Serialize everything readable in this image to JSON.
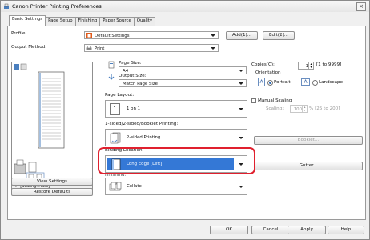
{
  "window": {
    "title": "Canon Printer Printing Preferences",
    "close": "×"
  },
  "tabs": [
    {
      "label": "Basic Settings",
      "active": true
    },
    {
      "label": "Page Setup"
    },
    {
      "label": "Finishing"
    },
    {
      "label": "Paper Source"
    },
    {
      "label": "Quality"
    }
  ],
  "profile": {
    "label": "Profile:",
    "value": "Default Settings",
    "add": "Add(1)...",
    "edit": "Edit(2)..."
  },
  "output_method": {
    "label": "Output Method:",
    "value": "Print"
  },
  "preview": {
    "status": "A4 [Scaling: Auto]"
  },
  "left_buttons": {
    "view_settings": "View Settings",
    "restore_defaults": "Restore Defaults"
  },
  "page_size": {
    "label": "Page Size:",
    "value": "A4"
  },
  "output_size": {
    "label": "Output Size:",
    "value": "Match Page Size"
  },
  "page_layout": {
    "label": "Page Layout:",
    "value": "1 on 1",
    "icon_text": "1"
  },
  "printing": {
    "label": "1-sided/2-sided/Booklet Printing:",
    "value": "2-sided Printing"
  },
  "binding": {
    "label": "Binding Location:",
    "value": "Long Edge [Left]",
    "partial_label": "Finishing:"
  },
  "finishing": {
    "value": "Collate"
  },
  "copies": {
    "label": "Copies(C):",
    "value": "1",
    "range": "[1 to 9999]"
  },
  "orientation": {
    "label": "Orientation",
    "portrait": "Portrait",
    "landscape": "Landscape",
    "selected": "portrait"
  },
  "manual_scaling": {
    "label": "Manual Scaling",
    "scaling_label": "Scaling:",
    "value": "100",
    "range": "% [25 to 200]"
  },
  "buttons": {
    "booklet": "Booklet...",
    "gutter": "Gutter...",
    "ok": "OK",
    "cancel": "Cancel",
    "apply": "Apply",
    "help": "Help"
  },
  "colors": {
    "accent": "#2a6ab8",
    "highlight": "#e0202e",
    "blue_field": "#3478d6"
  }
}
